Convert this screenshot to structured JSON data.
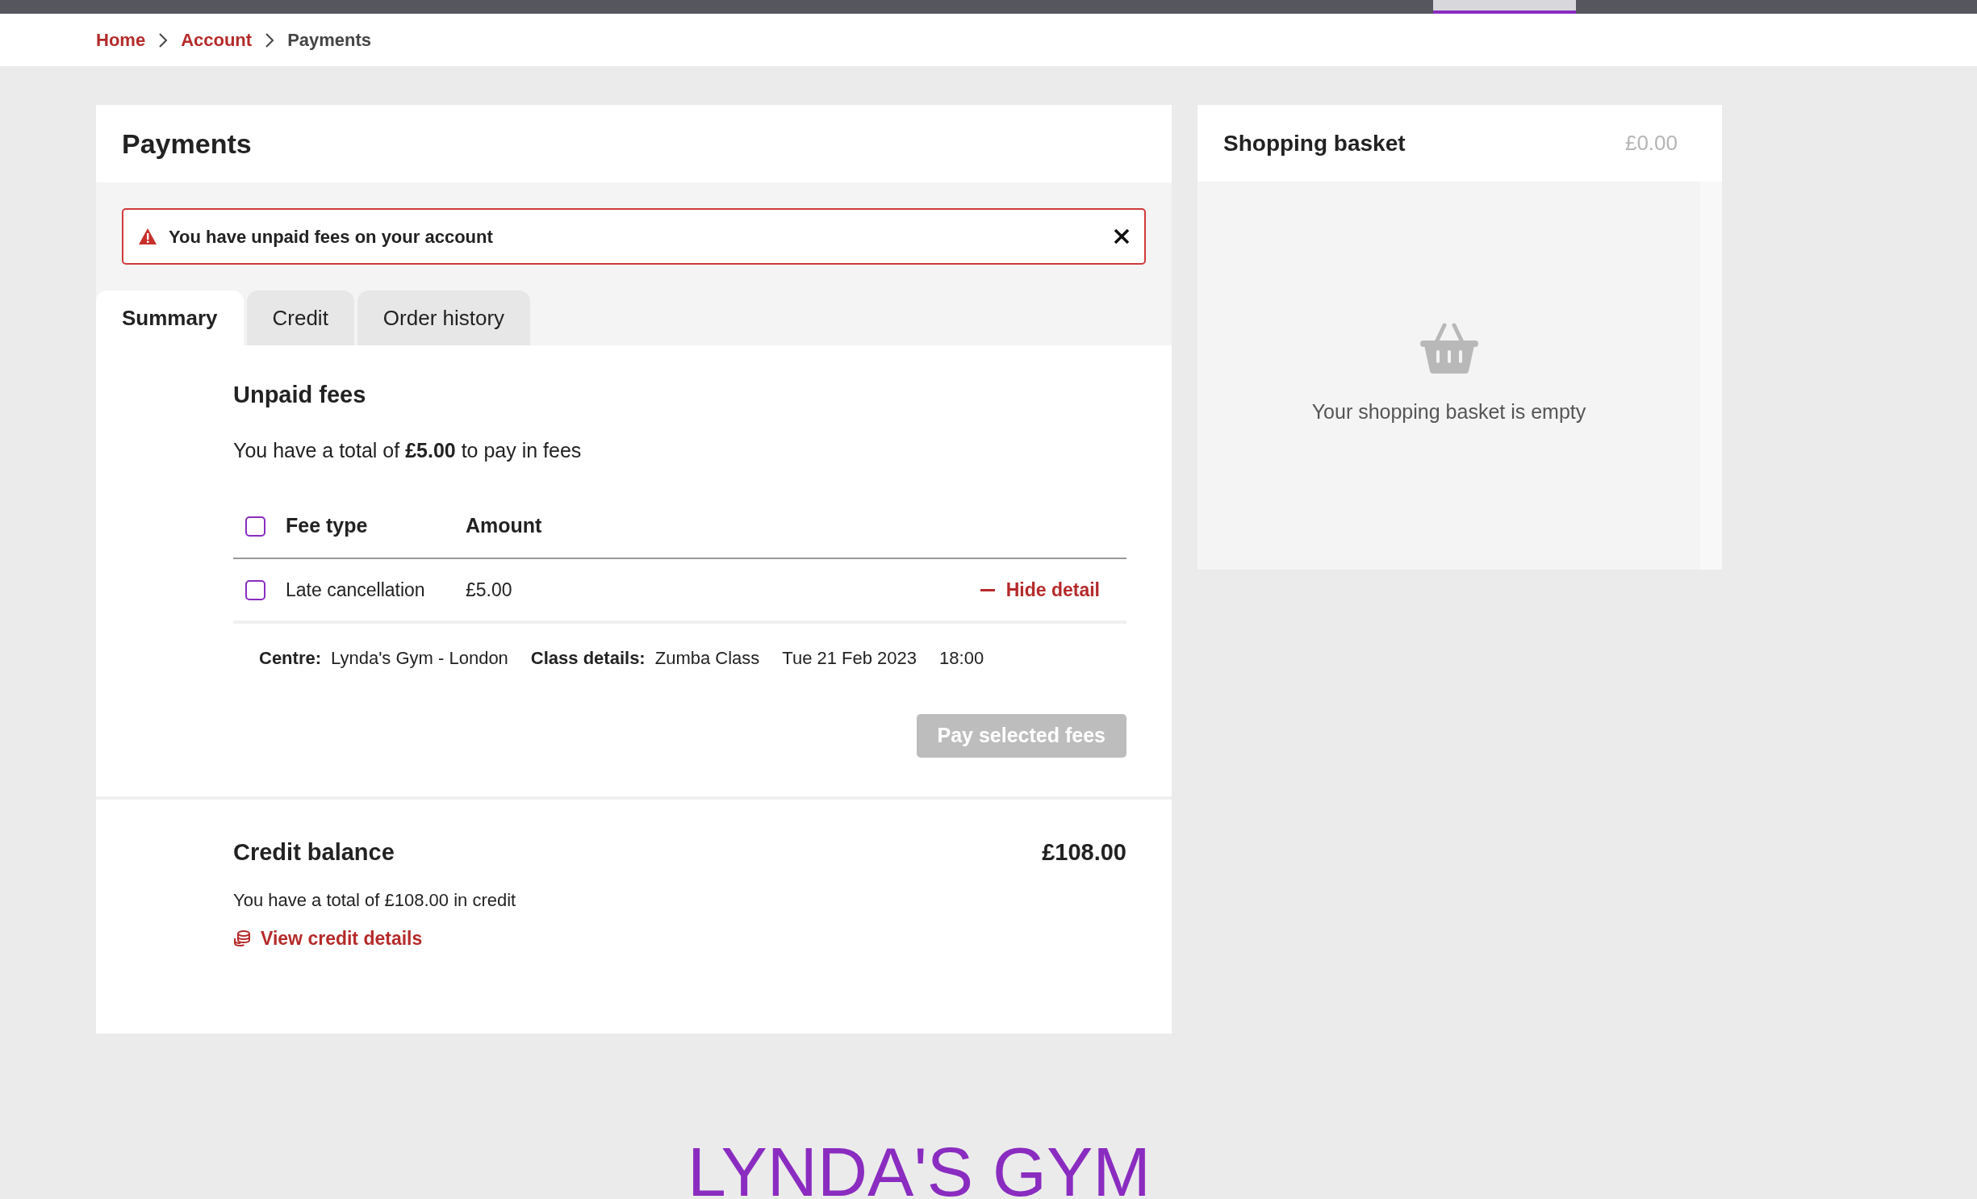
{
  "breadcrumb": [
    {
      "label": "Home",
      "link": true
    },
    {
      "label": "Account",
      "link": true
    },
    {
      "label": "Payments",
      "link": false
    }
  ],
  "page_title": "Payments",
  "alert": {
    "text": "You have unpaid fees on your account",
    "kind": "error"
  },
  "tabs": [
    {
      "label": "Summary",
      "selected": true
    },
    {
      "label": "Credit",
      "selected": false
    },
    {
      "label": "Order history",
      "selected": false
    }
  ],
  "unpaid_fees": {
    "title": "Unpaid fees",
    "summary": "You have a total of **£5.00** to pay in fees",
    "select_all_checked": false,
    "columns": [
      "Fee type",
      "Amount"
    ],
    "rows": [
      {
        "fee_type": "Late cancellation",
        "amount": "£5.00",
        "checked": false,
        "expanded": true,
        "toggle": "Hide detail",
        "details": [
          {
            "label": "Centre:",
            "value": "Lynda's Gym - London"
          },
          {
            "label": "Class details:",
            "value": "Zumba Class"
          },
          {
            "value": "Tue 21 Feb 2023"
          },
          {
            "value": "18:00"
          }
        ]
      }
    ],
    "pay_button": {
      "label": "Pay selected fees",
      "disabled": true
    }
  },
  "credit_balance": {
    "title": "Credit balance",
    "amount": "£108.00",
    "summary": "You have a total of £108.00 in credit",
    "link": "View credit details"
  },
  "basket": {
    "title": "Shopping basket",
    "total": "£0.00",
    "empty_message": "Your shopping basket is empty"
  },
  "footer": {
    "logo": "LYNDA'S GYM"
  }
}
